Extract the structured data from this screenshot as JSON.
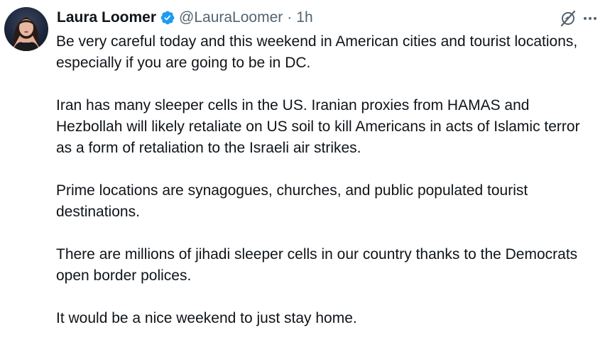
{
  "tweet": {
    "author_name": "Laura Loomer",
    "handle": "@LauraLoomer",
    "separator": "·",
    "time": "1h",
    "paragraphs": [
      "Be very careful today and this weekend in American cities and tourist locations, especially if you are going to be in DC.",
      "Iran has many sleeper cells in the US. Iranian proxies from HAMAS and Hezbollah will likely retaliate on US soil to kill Americans in acts of Islamic terror as a form of retaliation to the Israeli air strikes.",
      "Prime locations are synagogues, churches, and public populated tourist destinations.",
      "There are millions of jihadi sleeper cells in our country thanks to the Democrats open border polices.",
      "It would be a nice weekend to just stay home."
    ]
  },
  "icons": {
    "verified": "verified-badge-icon",
    "grok": "grok-icon",
    "more": "more-options-icon"
  },
  "colors": {
    "text": "#0f1419",
    "secondary": "#536471",
    "verified": "#1d9bf0"
  }
}
